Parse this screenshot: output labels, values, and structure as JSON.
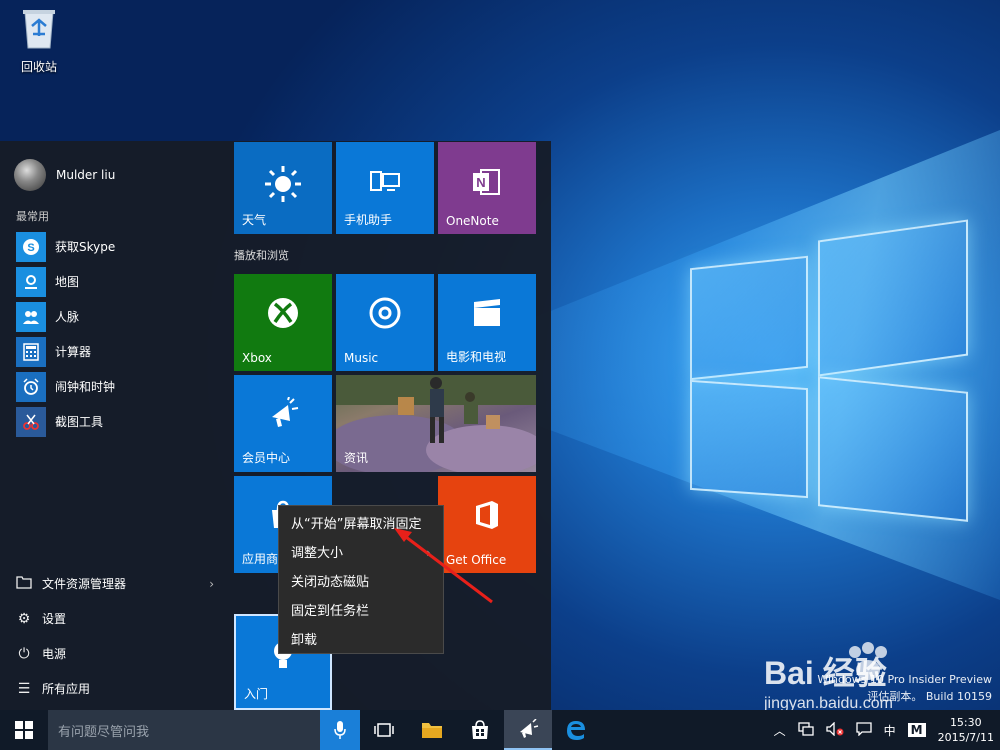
{
  "desktop": {
    "recycle_bin_label": "回收站",
    "watermark_line1": "Windows 10 Pro Insider Preview",
    "watermark_line2": "评估副本。 Build 10159",
    "baidu_logo_text": "Bai 经验",
    "baidu_url_text": "jingyan.baidu.com"
  },
  "start_menu": {
    "user_name": "Mulder liu",
    "most_used_label": "最常用",
    "most_used": [
      {
        "label": "获取Skype",
        "icon": "skype-icon",
        "color": "#1a8fe0"
      },
      {
        "label": "地图",
        "icon": "maps-icon",
        "color": "#1a8fe0"
      },
      {
        "label": "人脉",
        "icon": "people-icon",
        "color": "#1a8fe0"
      },
      {
        "label": "计算器",
        "icon": "calculator-icon",
        "color": "#1a6fc0"
      },
      {
        "label": "闹钟和时钟",
        "icon": "alarm-icon",
        "color": "#1a6fc0"
      },
      {
        "label": "截图工具",
        "icon": "snipping-icon",
        "color": "#2a5a9a"
      }
    ],
    "bottom": [
      {
        "label": "文件资源管理器",
        "icon": "folder-icon",
        "has_arrow": true
      },
      {
        "label": "设置",
        "icon": "gear-icon"
      },
      {
        "label": "电源",
        "icon": "power-icon"
      },
      {
        "label": "所有应用",
        "icon": "list-icon"
      }
    ],
    "group_label": "播放和浏览",
    "tiles": {
      "weather": "天气",
      "phone": "手机助手",
      "onenote": "OneNote",
      "xbox": "Xbox",
      "music": "Music",
      "movies": "电影和电视",
      "member": "会员中心",
      "news": "资讯",
      "store": "应用商店",
      "office": "Get Office",
      "getstarted": "入门"
    }
  },
  "context_menu": {
    "items": [
      "从“开始”屏幕取消固定",
      "调整大小",
      "关闭动态磁贴",
      "固定到任务栏",
      "卸载"
    ],
    "resize_arrow": "›"
  },
  "taskbar": {
    "search_placeholder": "有问题尽管问我",
    "ime_label": "中",
    "ime_mode": "M",
    "time": "15:30",
    "date": "2015/7/11"
  },
  "colors": {
    "tile_blue": "#0a78d7",
    "tile_green": "#117a10",
    "tile_purple": "#7f3b8f",
    "tile_orange": "#e6430f",
    "arrow_red": "#e8201a"
  }
}
